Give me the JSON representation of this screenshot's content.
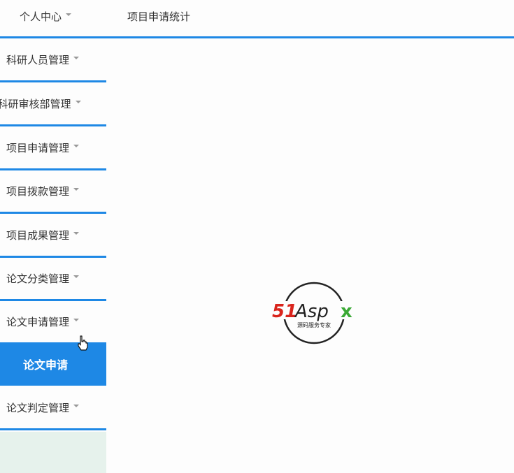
{
  "header": {
    "user_menu_label": "个人中心",
    "page_title": "项目申请统计"
  },
  "sidebar": {
    "items": [
      {
        "label": "科研人员管理"
      },
      {
        "label": "科研审核部管理"
      },
      {
        "label": "项目申请管理"
      },
      {
        "label": "项目拨款管理"
      },
      {
        "label": "项目成果管理"
      },
      {
        "label": "论文分类管理"
      },
      {
        "label": "论文申请管理"
      },
      {
        "label": "论文判定管理"
      }
    ],
    "active_subitem": "论文申请"
  },
  "watermark": {
    "brand_red": "51",
    "brand_dark": "Asp",
    "brand_green": "x",
    "tagline": "源码服务专家"
  },
  "colors": {
    "accent": "#1e88e5",
    "logo_red": "#d9241c",
    "logo_green": "#3aa935",
    "logo_dark": "#222222"
  }
}
